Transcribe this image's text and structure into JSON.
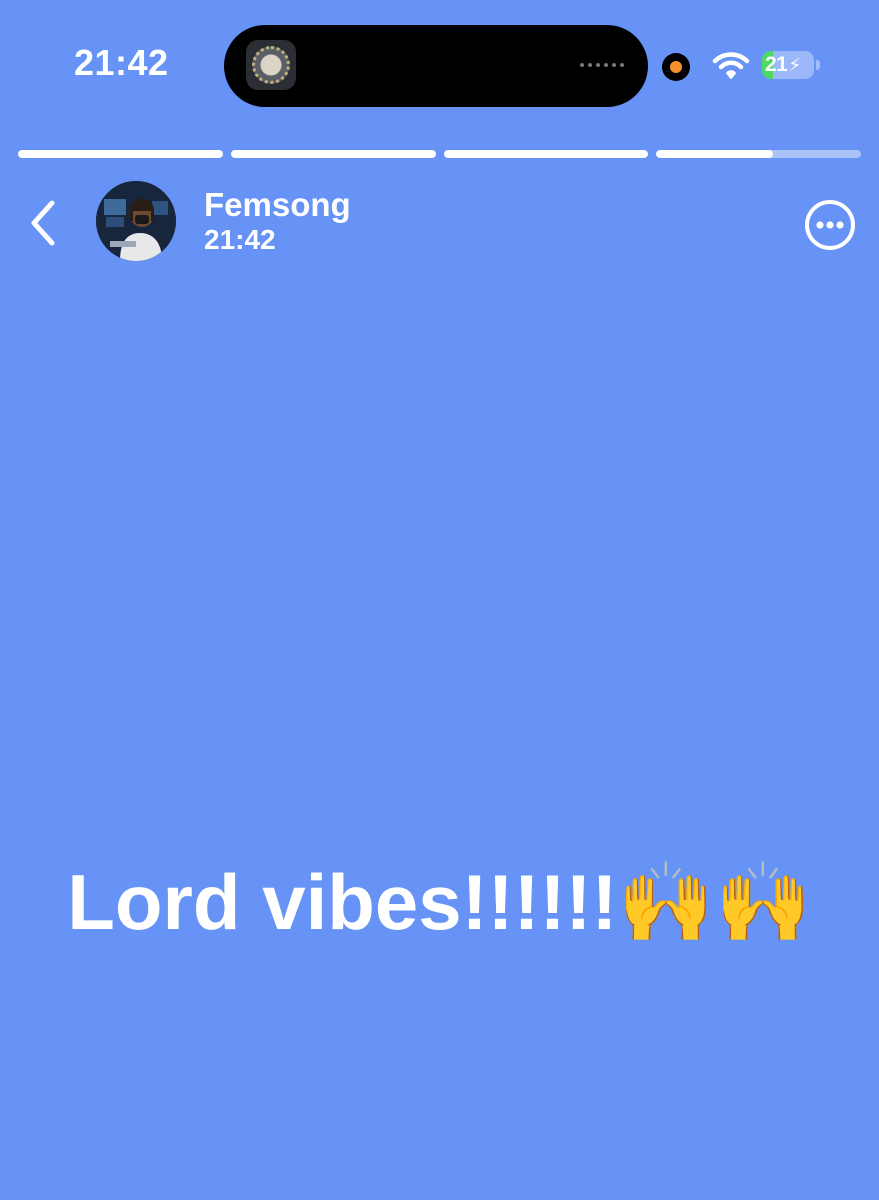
{
  "status_bar": {
    "time": "21:42",
    "battery_level": "21",
    "battery_fraction": 0.21,
    "battery_fill_color": "#4CD964",
    "recording_dot_color": "#F5922F",
    "icons": [
      "wifi-icon",
      "battery-icon",
      "charging-bolt-icon"
    ]
  },
  "story": {
    "background_color": "#6693F5",
    "progress": [
      1,
      1,
      1,
      0.57
    ],
    "user_name": "Femsong",
    "post_time": "21:42",
    "text": "Lord vibes!!!!!!🙌🙌",
    "icons": [
      "back-chevron-icon",
      "more-options-icon"
    ]
  }
}
